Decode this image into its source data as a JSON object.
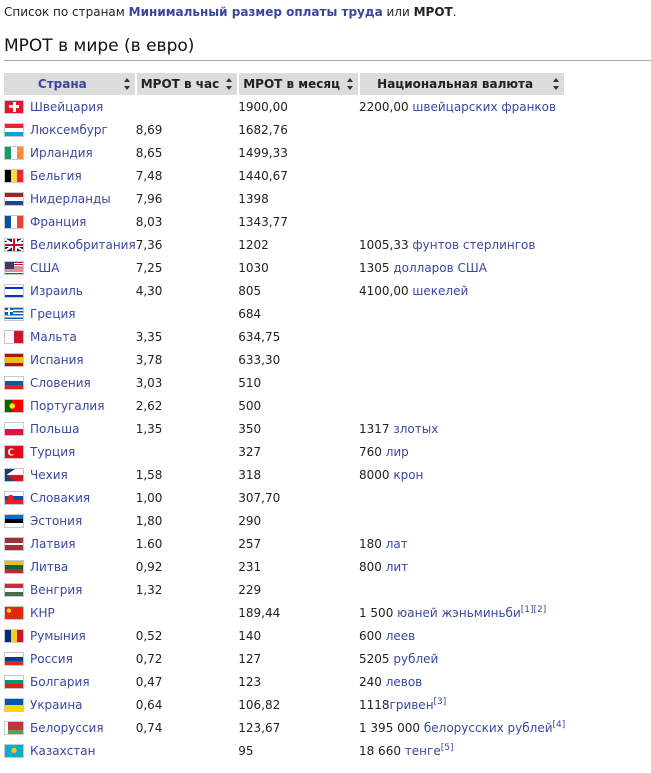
{
  "intro": {
    "prefix": "Список по странам",
    "link": "Минимальный размер оплаты труда",
    "middle": "или",
    "acronym": "МРОТ",
    "suffix": "."
  },
  "heading": "МРОТ в мире (в евро)",
  "table": {
    "headers": [
      "Страна",
      "МРОТ в час",
      "МРОТ в месяц",
      "Национальная валюта"
    ],
    "rows": [
      {
        "country": "Швейцария",
        "hour": "",
        "month": "1900,00",
        "currency": "2200,00",
        "currency_unit": "швейцарских франков",
        "flag": "switzerland"
      },
      {
        "country": "Люксембург",
        "hour": "8,69",
        "month": "1682,76",
        "currency": "",
        "currency_unit": "",
        "flag": "luxembourg"
      },
      {
        "country": "Ирландия",
        "hour": "8,65",
        "month": "1499,33",
        "currency": "",
        "currency_unit": "",
        "flag": "ireland"
      },
      {
        "country": "Бельгия",
        "hour": "7,48",
        "month": "1440,67",
        "currency": "",
        "currency_unit": "",
        "flag": "belgium"
      },
      {
        "country": "Нидерланды",
        "hour": "7,96",
        "month": "1398",
        "currency": "",
        "currency_unit": "",
        "flag": "netherlands"
      },
      {
        "country": "Франция",
        "hour": "8,03",
        "month": "1343,77",
        "currency": "",
        "currency_unit": "",
        "flag": "france"
      },
      {
        "country": "Великобритания",
        "hour": "7,36",
        "month": "1202",
        "currency": "1005,33",
        "currency_unit": "фунтов стерлингов",
        "flag": "uk"
      },
      {
        "country": "США",
        "hour": "7,25",
        "month": "1030",
        "currency": "1305",
        "currency_unit": "долларов США",
        "flag": "usa"
      },
      {
        "country": "Израиль",
        "hour": "4,30",
        "month": "805",
        "currency": "4100,00",
        "currency_unit": "шекелей",
        "flag": "israel"
      },
      {
        "country": "Греция",
        "hour": "",
        "month": "684",
        "currency": "",
        "currency_unit": "",
        "flag": "greece"
      },
      {
        "country": "Мальта",
        "hour": "3,35",
        "month": "634,75",
        "currency": "",
        "currency_unit": "",
        "flag": "malta"
      },
      {
        "country": "Испания",
        "hour": "3,78",
        "month": "633,30",
        "currency": "",
        "currency_unit": "",
        "flag": "spain"
      },
      {
        "country": "Словения",
        "hour": "3,03",
        "month": "510",
        "currency": "",
        "currency_unit": "",
        "flag": "slovenia"
      },
      {
        "country": "Португалия",
        "hour": "2,62",
        "month": "500",
        "currency": "",
        "currency_unit": "",
        "flag": "portugal"
      },
      {
        "country": "Польша",
        "hour": "1,35",
        "month": "350",
        "currency": "1317",
        "currency_unit": "злотых",
        "flag": "poland"
      },
      {
        "country": "Турция",
        "hour": "",
        "month": "327",
        "currency": "760",
        "currency_unit": "лир",
        "flag": "turkey"
      },
      {
        "country": "Чехия",
        "hour": "1,58",
        "month": "318",
        "currency": "8000",
        "currency_unit": "крон",
        "flag": "czech"
      },
      {
        "country": "Словакия",
        "hour": "1,00",
        "month": "307,70",
        "currency": "",
        "currency_unit": "",
        "flag": "slovakia"
      },
      {
        "country": "Эстония",
        "hour": "1,80",
        "month": "290",
        "currency": "",
        "currency_unit": "",
        "flag": "estonia"
      },
      {
        "country": "Латвия",
        "hour": "1.60",
        "month": "257",
        "currency": "180",
        "currency_unit": "лат",
        "flag": "latvia"
      },
      {
        "country": "Литва",
        "hour": "0,92",
        "month": "231",
        "currency": "800",
        "currency_unit": "лит",
        "flag": "lithuania"
      },
      {
        "country": "Венгрия",
        "hour": "1,32",
        "month": "229",
        "currency": "",
        "currency_unit": "",
        "flag": "hungary"
      },
      {
        "country": "КНР",
        "hour": "",
        "month": "189,44",
        "currency": "1 500",
        "currency_unit": "юаней жэньминьби",
        "refs": [
          "[1]",
          "[2]"
        ],
        "flag": "china"
      },
      {
        "country": "Румыния",
        "hour": "0,52",
        "month": "140",
        "currency": "600",
        "currency_unit": "леев",
        "flag": "romania"
      },
      {
        "country": "Россия",
        "hour": "0,72",
        "month": "127",
        "currency": "5205",
        "currency_unit": "рублей",
        "flag": "russia"
      },
      {
        "country": "Болгария",
        "hour": "0,47",
        "month": "123",
        "currency": "240",
        "currency_unit": "левов",
        "flag": "bulgaria"
      },
      {
        "country": "Украина",
        "hour": "0,64",
        "month": "106,82",
        "currency": "1118",
        "currency_unit": "гривен",
        "refs": [
          "[3]"
        ],
        "nospace": true,
        "flag": "ukraine"
      },
      {
        "country": "Белоруссия",
        "hour": "0,74",
        "month": "123,67",
        "currency": "1 395 000",
        "currency_unit": "белорусских рублей",
        "refs": [
          "[4]"
        ],
        "flag": "belarus"
      },
      {
        "country": "Казахстан",
        "hour": "",
        "month": "95",
        "currency": "18 660",
        "currency_unit": "тенге",
        "refs": [
          "[5]"
        ],
        "flag": "kazakhstan"
      }
    ]
  }
}
